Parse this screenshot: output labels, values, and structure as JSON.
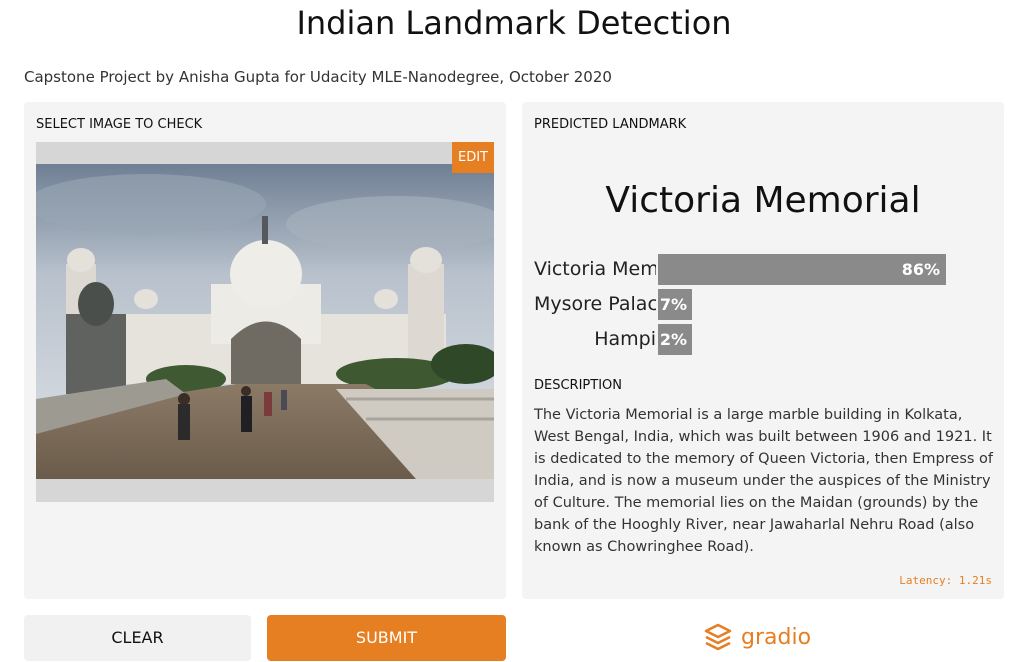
{
  "header": {
    "title": "Indian Landmark Detection",
    "subtitle": "Capstone Project by Anisha Gupta for Udacity MLE-Nanodegree, October 2020"
  },
  "input_panel": {
    "label": "SELECT IMAGE TO CHECK",
    "edit_label": "EDIT"
  },
  "output_panel": {
    "label": "PREDICTED LANDMARK",
    "prediction": "Victoria Memorial",
    "confidences": [
      {
        "label": "Victoria Memorial",
        "value": 86,
        "display": "86%"
      },
      {
        "label": "Mysore Palace",
        "value": 7,
        "display": "7%"
      },
      {
        "label": "Hampi",
        "value": 2,
        "display": "2%"
      }
    ],
    "description_label": "DESCRIPTION",
    "description": "The Victoria Memorial is a large marble building in Kolkata, West Bengal, India, which was built between 1906 and 1921. It is dedicated to the memory of Queen Victoria, then Empress of India, and is now a museum under the auspices of the Ministry of Culture. The memorial lies on the Maidan (grounds) by the bank of the Hooghly River, near Jawaharlal Nehru Road (also known as Chowringhee Road).",
    "latency": "Latency: 1.21s"
  },
  "buttons": {
    "clear": "CLEAR",
    "submit": "SUBMIT"
  },
  "footer": {
    "brand": "gradio"
  },
  "colors": {
    "accent": "#e67e22",
    "bar": "#8a8a8a",
    "panel": "#f4f4f4"
  }
}
